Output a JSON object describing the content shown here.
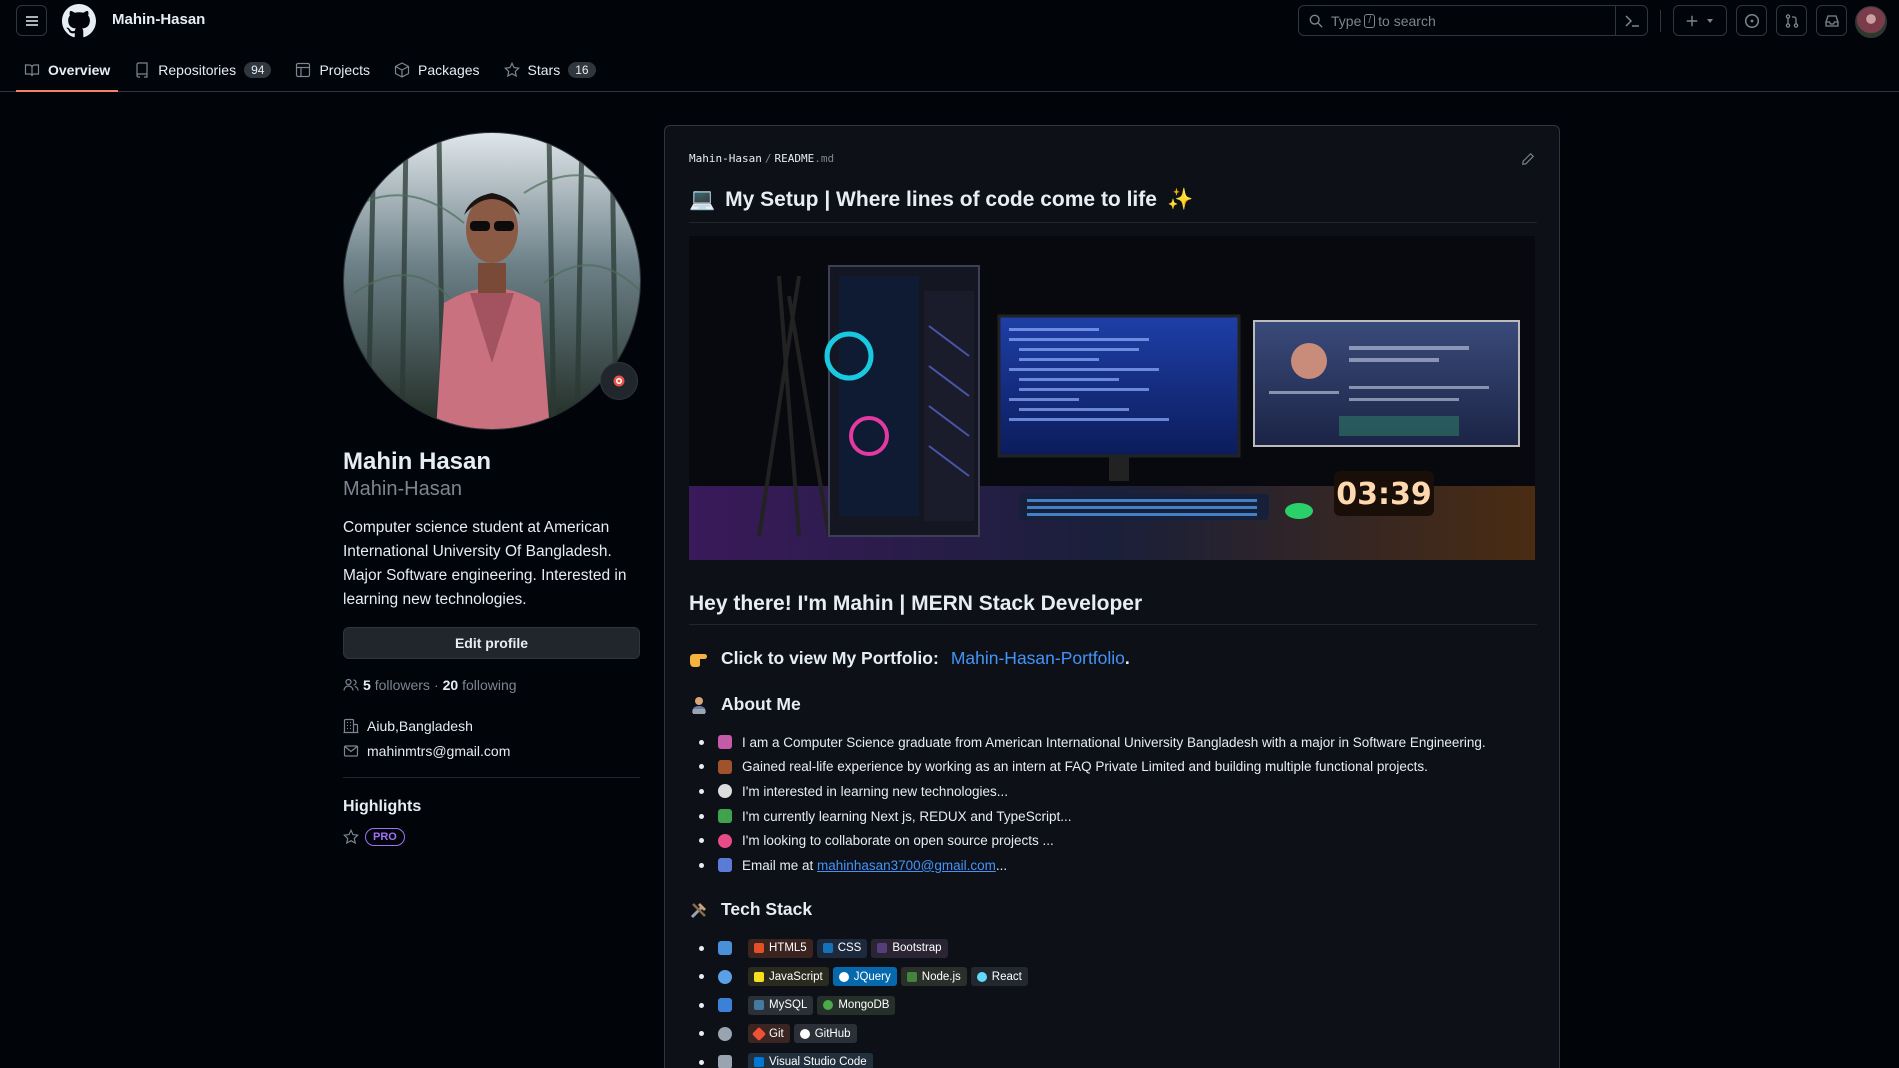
{
  "header": {
    "owner": "Mahin-Hasan",
    "search": {
      "prefix": "Type",
      "key": "/",
      "suffix": "to search"
    }
  },
  "tabs": [
    {
      "label": "Overview",
      "icon": "book-icon",
      "active": true
    },
    {
      "label": "Repositories",
      "icon": "repo-icon",
      "count": "94"
    },
    {
      "label": "Projects",
      "icon": "table-icon"
    },
    {
      "label": "Packages",
      "icon": "package-icon"
    },
    {
      "label": "Stars",
      "icon": "star-icon",
      "count": "16"
    }
  ],
  "profile": {
    "name": "Mahin Hasan",
    "login": "Mahin-Hasan",
    "bio": "Computer science student at American International University Of Bangladesh. Major Software engineering. Interested in learning new technologies.",
    "edit_label": "Edit profile",
    "followers_count": "5",
    "followers_label": "followers",
    "dot": "·",
    "following_count": "20",
    "following_label": "following",
    "organization": "Aiub,Bangladesh",
    "email": "mahinmtrs@gmail.com",
    "highlights_title": "Highlights",
    "pro_badge": "PRO"
  },
  "readme": {
    "path_owner": "Mahin-Hasan",
    "path_sep": "/",
    "path_file": "README",
    "path_ext": ".md",
    "title": "My Setup | Where lines of code come to life",
    "title_emoji_left": "💻",
    "title_emoji_right": "✨",
    "banner_clock": "03:39",
    "heading2": "Hey there! I'm Mahin | MERN Stack Developer",
    "portfolio_text": "Click to view My Portfolio:",
    "portfolio_link": "Mahin-Hasan-Portfolio",
    "portfolio_period": ".",
    "about_title": "About Me",
    "about_items": [
      {
        "text": "I am a Computer Science graduate from American International University Bangladesh with a major in Software Engineering.",
        "color": "#c45aa8"
      },
      {
        "text": "Gained real-life experience by working as an intern at FAQ Private Limited and building multiple functional projects.",
        "color": "#a0522d"
      },
      {
        "text": "I'm interested in learning new technologies...",
        "color": "#dddddd"
      },
      {
        "text": "I'm currently learning Next js, REDUX and TypeScript...",
        "color": "#3fa34d"
      },
      {
        "text": "I'm looking to collaborate on open source projects ...",
        "color": "#e84b8a"
      },
      {
        "text": "Email me at",
        "link": "mahinhasan3700@gmail.com",
        "after": "...",
        "color": "#5a7bd6"
      }
    ],
    "tech_title": "Tech Stack",
    "tech_rows": [
      {
        "icon_color": "#4a90d9",
        "badges": [
          {
            "label": "HTML5",
            "bg": "#3b2320",
            "icon": "#e34f26"
          },
          {
            "label": "CSS",
            "bg": "#1d2a3d",
            "icon": "#1572b6"
          },
          {
            "label": "Bootstrap",
            "bg": "#2a2433",
            "icon": "#563d7c"
          }
        ]
      },
      {
        "icon_color": "#5aa0e6",
        "badges": [
          {
            "label": "JavaScript",
            "bg": "#2b2a1f",
            "icon": "#f7df1e"
          },
          {
            "label": "JQuery",
            "bg": "#0769ad",
            "icon": "#ffffff"
          },
          {
            "label": "Node.js",
            "bg": "#2a2f2a",
            "icon": "#43853d"
          },
          {
            "label": "React",
            "bg": "#22282e",
            "icon": "#61dafb"
          }
        ]
      },
      {
        "icon_color": "#3b82d6",
        "badges": [
          {
            "label": "MySQL",
            "bg": "#2b2f36",
            "icon": "#4479a1"
          },
          {
            "label": "MongoDB",
            "bg": "#26302a",
            "icon": "#4ea94b"
          }
        ]
      },
      {
        "icon_color": "#9aa4b0",
        "badges": [
          {
            "label": "Git",
            "bg": "#3a2522",
            "icon": "#f05033"
          },
          {
            "label": "GitHub",
            "bg": "#2b2f36",
            "icon": "#ffffff"
          }
        ]
      },
      {
        "icon_color": "#9aa4b0",
        "badges": [
          {
            "label": "Visual Studio Code",
            "bg": "#22303e",
            "icon": "#0078d7"
          }
        ]
      }
    ]
  },
  "colors": {
    "background": "#010409",
    "card": "#0d1117",
    "border": "#30363d",
    "link": "#4493f8",
    "tab_underline": "#f78166",
    "pro": "#a371f7"
  }
}
